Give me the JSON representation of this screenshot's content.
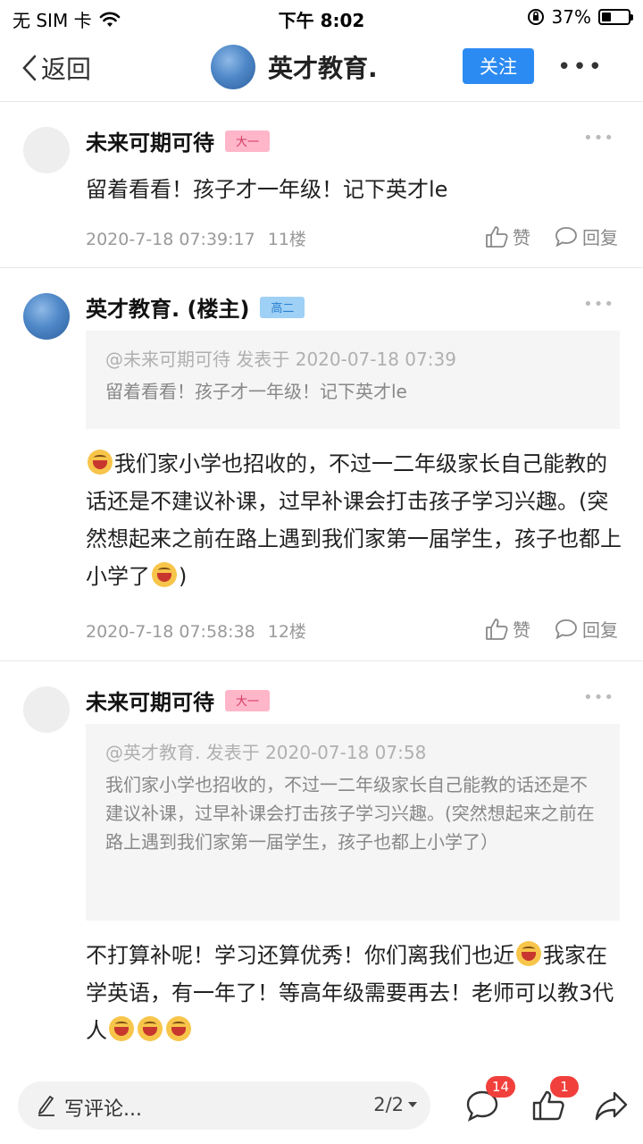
{
  "status_bar": {
    "carrier": "无 SIM 卡",
    "time": "下午 8:02",
    "battery": "37%",
    "battery_level": 0.37
  },
  "nav": {
    "back_label": "返回",
    "title": "英才教育.",
    "follow_label": "关注",
    "more_label": "•••"
  },
  "posts": [
    {
      "username": "未来可期可待",
      "badge": "大一",
      "content": "留着看看！孩子才一年级！记下英才le",
      "time": "2020-7-18 07:39:17",
      "floor": "11楼",
      "like_label": "赞",
      "reply_label": "回复"
    },
    {
      "username": "英才教育. (楼主)",
      "badge": "高二",
      "quote_head": "@未来可期可待 发表于 2020-07-18 07:39",
      "quote_body": "留着看看！孩子才一年级！记下英才le",
      "content_parts": [
        "我们家小学也招收的，不过一二年级家长自己能教的话还是不建议补课，过早补课会打击孩子学习兴趣。(突然想起来之前在路上遇到我们家第一届学生，孩子也都上小学了",
        ")"
      ],
      "time": "2020-7-18 07:58:38",
      "floor": "12楼",
      "like_label": "赞",
      "reply_label": "回复"
    },
    {
      "username": "未来可期可待",
      "badge": "大一",
      "quote_head": "@英才教育. 发表于 2020-07-18 07:58",
      "quote_body": "我们家小学也招收的，不过一二年级家长自己能教的话还是不建议补课，过早补课会打击孩子学习兴趣。(突然想起来之前在路上遇到我们家第一届学生，孩子也都上小学了）",
      "content_parts": [
        "不打算补呢！学习还算优秀！你们离我们也近",
        "我家在学英语，有一年了！等高年级需要再去！老师可以教3代人"
      ]
    }
  ],
  "bottom_bar": {
    "comment_placeholder": "写评论...",
    "page_indicator": "2/2",
    "comment_count": "14",
    "like_count": "1"
  }
}
